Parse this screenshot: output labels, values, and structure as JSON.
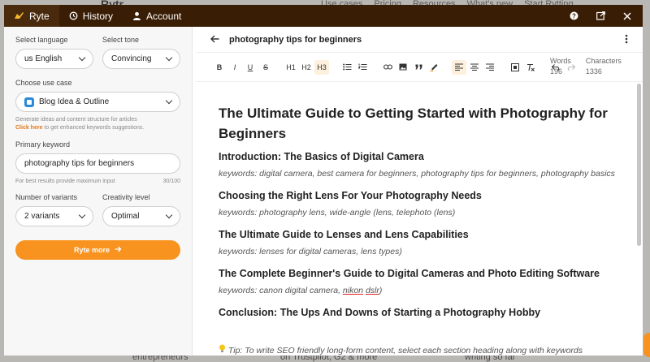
{
  "background": {
    "logo": "Rytr",
    "nav": [
      "Use cases",
      "Pricing",
      "Resources",
      "What's new",
      "Start Rytting"
    ],
    "footer": [
      "entrepreneurs",
      "on Trustpilot, G2 & more",
      "writing so far"
    ]
  },
  "topbar": {
    "tabs": [
      {
        "label": "Ryte",
        "icon": "pen-icon"
      },
      {
        "label": "History",
        "icon": "history-icon"
      },
      {
        "label": "Account",
        "icon": "user-icon"
      }
    ]
  },
  "left": {
    "language_label": "Select language",
    "language_value": "us English",
    "tone_label": "Select tone",
    "tone_value": "Convincing",
    "usecase_label": "Choose use case",
    "usecase_value": "Blog Idea & Outline",
    "usecase_hint": "Generate ideas and content structure for articles",
    "click_here": "Click here",
    "click_here_rest": " to get enhanced keywords suggestions.",
    "keyword_label": "Primary keyword",
    "keyword_value": "photography tips for beginners",
    "keyword_hint": "For best results provide maximum input",
    "keyword_count": "30/100",
    "variants_label": "Number of variants",
    "variants_value": "2 variants",
    "creativity_label": "Creativity level",
    "creativity_value": "Optimal",
    "cta": "Ryte more"
  },
  "right": {
    "title": "photography tips for beginners",
    "toolbar": [
      "B",
      "I",
      "U",
      "S",
      "H1",
      "H2",
      "H3"
    ],
    "words_label": "Words",
    "words_value": "196",
    "chars_label": "Characters",
    "chars_value": "1336"
  },
  "doc": {
    "heading": "The Ultimate Guide to Getting Started with Photography for Beginners",
    "sections": [
      {
        "title": "Introduction: The Basics of Digital Camera",
        "keywords": "keywords: digital camera, best camera for beginners, photography tips for beginners, photography basics"
      },
      {
        "title": "Choosing the Right Lens For Your Photography Needs",
        "keywords": "keywords: photography lens, wide-angle (lens, telephoto (lens)"
      },
      {
        "title": "The Ultimate Guide to Lenses and Lens Capabilities",
        "keywords": "keywords: lenses for digital cameras, lens types)"
      },
      {
        "title": "The Complete Beginner's Guide to Digital Cameras and Photo Editing Software",
        "keywords_pre": "keywords: canon digital camera, ",
        "kw_a": "nikon",
        "kw_b": "dslr",
        "keywords_post": ")"
      },
      {
        "title": "Conclusion: The Ups And Downs of Starting a Photography Hobby"
      }
    ],
    "tip": "Tip: To write SEO friendly long-form content, select each section heading along with keywords"
  },
  "colors": {
    "topbar": "#3a1d05",
    "accent": "#f7931e"
  }
}
